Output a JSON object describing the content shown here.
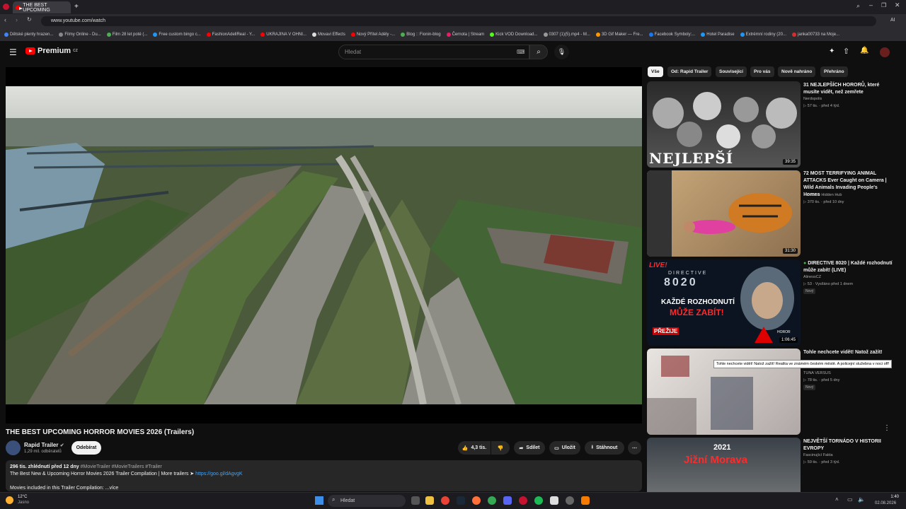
{
  "browser": {
    "tab_title": "THE BEST UPCOMING",
    "url": "www.youtube.com/watch",
    "ai_label": "AI",
    "bookmarks": [
      "Dětské plenty hrazen...",
      "Filmy Online - Du...",
      "Film 28 let poté (...",
      "Free custom bingo c...",
      "FashionAdellReal - Y...",
      "UKRAJINA V OHNI...",
      "Movavi Effects",
      "Nový Přítel Adély -...",
      "Blog :: Fionin-blog",
      "Černota | Stream",
      "Kick VOD Download...",
      "0307 (1)(5).mp4 - M...",
      "3D Gif Maker — Fre...",
      "Facebook Symboly:...",
      "Hotel Paradise",
      "Extrémní rodiny (20...",
      "janka00733 na Moje..."
    ]
  },
  "youtube": {
    "logo": "Premium",
    "region": "CZ",
    "search_placeholder": "Hledat"
  },
  "video": {
    "title": "THE BEST UPCOMING HORROR MOVIES 2026 (Trailers)",
    "channel": "Rapid Trailer",
    "subscribers": "1,29 mil. odběratelů",
    "subscribe_label": "Odebírat",
    "likes": "4,3 tis.",
    "share": "Sdílet",
    "save": "Uložit",
    "download": "Stáhnout",
    "views_line": "296 tis. zhlédnutí  před 12 dny",
    "hashtags": "#MovieTrailer #MovieTrailers #Trailer",
    "desc_line": "The Best New & Upcoming Horror Movies 2026 Trailer Compilation | More trailers ➤ ",
    "desc_link": "https://goo.gl/dAgvgK",
    "desc_more": "Movies included in this Trailer Compilation: ...více"
  },
  "chips": [
    "Vše",
    "Od: Rapid Trailer",
    "Související",
    "Pro vás",
    "Nově nahráno",
    "Přehráno"
  ],
  "recommendations": [
    {
      "title": "31 NEJLEPŠÍCH HORORŮ, které musíte vidět, než zemřete",
      "channel": "Nerdopolis",
      "meta": "57 tis. · před 4 týd.",
      "thumb_text": "NEJLEPŠÍ HORORY",
      "duration": "39:35"
    },
    {
      "title": "72 MOST TERRIFYING ANIMAL ATTACKS Ever Caught on Camera | Wild Animals Invading People's Homes",
      "channel": "Incredible Hidden Hub",
      "meta": "370 tis. · před 10 dny",
      "duration": "31:30"
    },
    {
      "title": "DIRECTIVE 8020 | Každé rozhodnutí může zabít! (LIVE)",
      "channel": "AlinessCZ",
      "meta": "53 · Vysíláno před 1 dnem",
      "badge": "Nový",
      "thumb_live": "LIVE!",
      "thumb_text1": "DIRECTIVE",
      "thumb_text2": "8020",
      "thumb_text3": "KAŽDÉ ROZHODNUTÍ",
      "thumb_text4": "MŮŽE ZABÍT!",
      "thumb_text5": "PŘEŽIJE",
      "thumb_text6": "HOROR",
      "duration": "1:06:45"
    },
    {
      "title": "Tohle nechcete vidět! Natož zažít!",
      "channel": "TUNA VERSUS",
      "meta": "78 tis. · před 5 dny",
      "badge": "Nový",
      "tooltip": "Tohle nechcete vidět! Natož zažít! Realita ve známém českém městě. A policejní služebna v noci off!"
    },
    {
      "title": "NEJVĚTŠÍ TORNÁDO V HISTORII EVROPY",
      "channel": "Fascinující Fakta",
      "meta": "59 tis. · před 3 týd.",
      "thumb_text1": "2021",
      "thumb_text2": "Jižní Morava"
    }
  ],
  "taskbar": {
    "temp": "12°C",
    "weather": "Jasno",
    "search": "Hledat",
    "time": "1:40",
    "date": "02.08.2026"
  },
  "colors": {
    "bg": "#0f0f0f",
    "accent": "#ff0000",
    "chip_active": "#f1f1f1",
    "link": "#3ea6ff"
  }
}
